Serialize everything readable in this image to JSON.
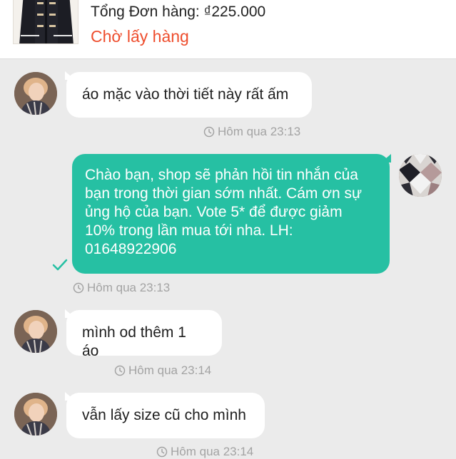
{
  "order": {
    "total": "Tổng Đơn hàng: ₫225.000",
    "status": "Chờ lấy hàng"
  },
  "messages": [
    {
      "direction": "incoming",
      "text": "áo mặc vào thời tiết này rất ấm",
      "time": "Hôm qua 23:13"
    },
    {
      "direction": "outgoing",
      "lines": [
        "Chào bạn, shop sẽ phản hồi tin nhắn của",
        "bạn trong thời gian sớm nhất. Cám ơn sự",
        "ủng hộ của bạn. Vote 5* để được giảm",
        "10% trong lần mua tới nha. LH:",
        "01648922906"
      ],
      "time": "Hôm qua 23:13",
      "status_icon": "check-icon"
    },
    {
      "direction": "incoming",
      "text": "mình od thêm 1 áo",
      "time": "Hôm qua 23:14"
    },
    {
      "direction": "incoming",
      "text": "vẫn lấy size cũ cho mình",
      "time": "Hôm qua 23:14"
    }
  ],
  "icons": {
    "timestamp": "clock-icon",
    "sent": "check-icon"
  },
  "colors": {
    "outgoing_bubble": "#26c0a3",
    "status_accent": "#ee4d2d",
    "background": "#ebebeb"
  }
}
